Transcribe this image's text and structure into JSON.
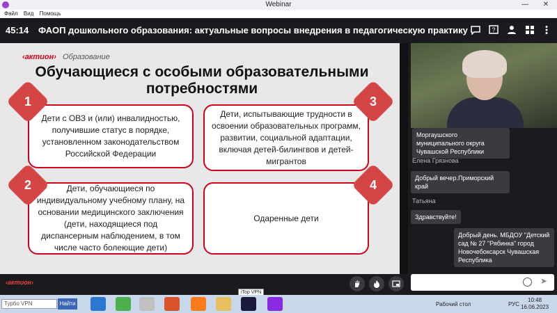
{
  "window": {
    "title": "Webinar",
    "minimize": "—",
    "close": "✕"
  },
  "menu": [
    "Файл",
    "Вид",
    "Помощь"
  ],
  "header": {
    "timer": "45:14",
    "title": "ФАОП дошкольного образования: актуальные вопросы внедрения в педагогическую практику"
  },
  "slide": {
    "brand": "‹актион›",
    "brand_sub": "Образование",
    "title": "Обучающиеся с особыми образовательными потребностями",
    "cards": [
      {
        "num": "1",
        "text": "Дети с ОВЗ и (или) инвалидностью, получившие статус в порядке, установленном законодательством Российской Федерации"
      },
      {
        "num": "2",
        "text": "Дети, обучающиеся по индивидуальному учебному плану, на основании медицинского заключения (дети, находящиеся под диспансерным наблюдением, в том числе часто болеющие дети)"
      },
      {
        "num": "3",
        "text": "Дети, испытывающие трудности в освоении образовательных программ, развитии, социальной адаптации, включая детей-билингвов и детей-мигрантов"
      },
      {
        "num": "4",
        "text": "Одаренные дети"
      }
    ],
    "footer_brand": "‹актион›"
  },
  "chat": {
    "messages": [
      {
        "author": "",
        "text": "Моргаушского муниципального округа Чувашской Республики"
      },
      {
        "author": "Елена Грязнова",
        "text": "Добрый вечер.Приморский край"
      },
      {
        "author": "Татьяна",
        "text": "Здравствуйте!"
      },
      {
        "author": "",
        "text": "Добрый день. МБДОУ \"Детский сад № 27 \"Рябинка\" город Новочебоксарск Чувашская Республика"
      }
    ],
    "input_placeholder": ""
  },
  "taskbar": {
    "search_text": "Турбо VPN",
    "search_button": "Найти",
    "tooltip": "iTop VPN",
    "desktop_label": "Рабочий стол",
    "lang": "РУС",
    "time": "10:48",
    "date": "16.06.2023"
  },
  "colors": {
    "accent": "#d0021b",
    "background": "#1b1b1f"
  }
}
